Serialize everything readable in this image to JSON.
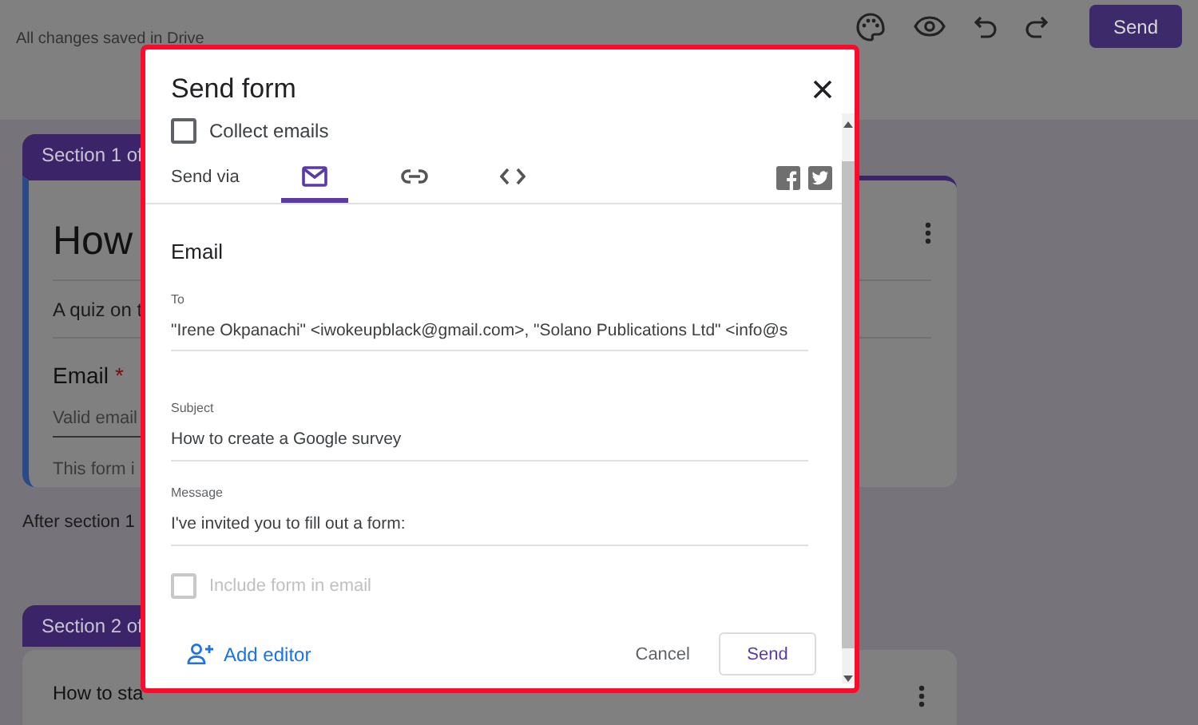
{
  "top_bar": {
    "status": "All changes saved in Drive",
    "send_button": "Send"
  },
  "section_1": {
    "tab": "Section 1 of",
    "title": "How",
    "description": "A quiz on t",
    "question": "Email",
    "required_mark": "*",
    "answer_placeholder": "Valid email",
    "note": "This form i"
  },
  "after_section": "After section 1",
  "section_2": {
    "tab": "Section 2 of",
    "title": "How to sta"
  },
  "dialog": {
    "title": "Send form",
    "collect_emails": {
      "label": "Collect emails",
      "checked": false
    },
    "send_via": {
      "label": "Send via",
      "tabs": [
        {
          "kind": "email",
          "selected": true
        },
        {
          "kind": "link",
          "selected": false
        },
        {
          "kind": "embed",
          "selected": false
        }
      ]
    },
    "heading": "Email",
    "fields": [
      {
        "label": "To",
        "value": "\"Irene Okpanachi\" <iwokeupblack@gmail.com>, \"Solano Publications Ltd\" <info@s"
      },
      {
        "label": "Subject",
        "value": "How to create a Google survey"
      },
      {
        "label": "Message",
        "value": "I've invited you to fill out a form:"
      }
    ],
    "include_form": {
      "label": "Include form in email",
      "checked": false,
      "disabled": true
    },
    "add_editor": "Add editor",
    "cancel": "Cancel",
    "send": "Send"
  }
}
